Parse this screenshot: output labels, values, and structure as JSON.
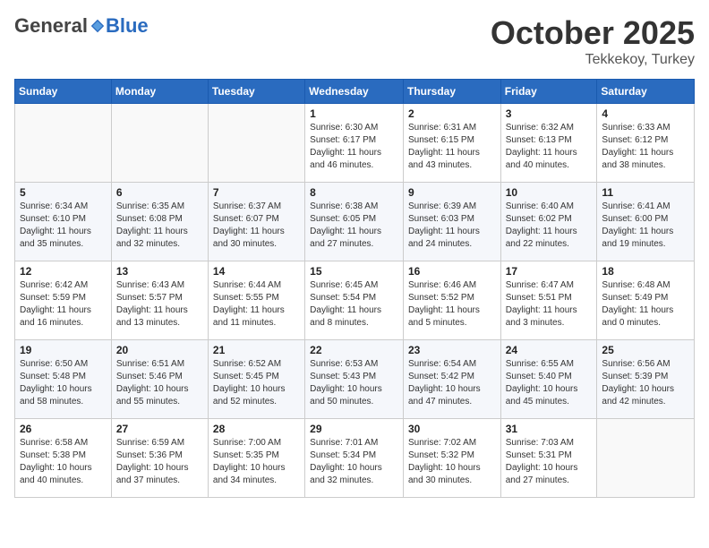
{
  "header": {
    "logo_general": "General",
    "logo_blue": "Blue",
    "month_title": "October 2025",
    "location": "Tekkekoy, Turkey"
  },
  "days_of_week": [
    "Sunday",
    "Monday",
    "Tuesday",
    "Wednesday",
    "Thursday",
    "Friday",
    "Saturday"
  ],
  "weeks": [
    [
      {
        "day": "",
        "info": ""
      },
      {
        "day": "",
        "info": ""
      },
      {
        "day": "",
        "info": ""
      },
      {
        "day": "1",
        "info": "Sunrise: 6:30 AM\nSunset: 6:17 PM\nDaylight: 11 hours\nand 46 minutes."
      },
      {
        "day": "2",
        "info": "Sunrise: 6:31 AM\nSunset: 6:15 PM\nDaylight: 11 hours\nand 43 minutes."
      },
      {
        "day": "3",
        "info": "Sunrise: 6:32 AM\nSunset: 6:13 PM\nDaylight: 11 hours\nand 40 minutes."
      },
      {
        "day": "4",
        "info": "Sunrise: 6:33 AM\nSunset: 6:12 PM\nDaylight: 11 hours\nand 38 minutes."
      }
    ],
    [
      {
        "day": "5",
        "info": "Sunrise: 6:34 AM\nSunset: 6:10 PM\nDaylight: 11 hours\nand 35 minutes."
      },
      {
        "day": "6",
        "info": "Sunrise: 6:35 AM\nSunset: 6:08 PM\nDaylight: 11 hours\nand 32 minutes."
      },
      {
        "day": "7",
        "info": "Sunrise: 6:37 AM\nSunset: 6:07 PM\nDaylight: 11 hours\nand 30 minutes."
      },
      {
        "day": "8",
        "info": "Sunrise: 6:38 AM\nSunset: 6:05 PM\nDaylight: 11 hours\nand 27 minutes."
      },
      {
        "day": "9",
        "info": "Sunrise: 6:39 AM\nSunset: 6:03 PM\nDaylight: 11 hours\nand 24 minutes."
      },
      {
        "day": "10",
        "info": "Sunrise: 6:40 AM\nSunset: 6:02 PM\nDaylight: 11 hours\nand 22 minutes."
      },
      {
        "day": "11",
        "info": "Sunrise: 6:41 AM\nSunset: 6:00 PM\nDaylight: 11 hours\nand 19 minutes."
      }
    ],
    [
      {
        "day": "12",
        "info": "Sunrise: 6:42 AM\nSunset: 5:59 PM\nDaylight: 11 hours\nand 16 minutes."
      },
      {
        "day": "13",
        "info": "Sunrise: 6:43 AM\nSunset: 5:57 PM\nDaylight: 11 hours\nand 13 minutes."
      },
      {
        "day": "14",
        "info": "Sunrise: 6:44 AM\nSunset: 5:55 PM\nDaylight: 11 hours\nand 11 minutes."
      },
      {
        "day": "15",
        "info": "Sunrise: 6:45 AM\nSunset: 5:54 PM\nDaylight: 11 hours\nand 8 minutes."
      },
      {
        "day": "16",
        "info": "Sunrise: 6:46 AM\nSunset: 5:52 PM\nDaylight: 11 hours\nand 5 minutes."
      },
      {
        "day": "17",
        "info": "Sunrise: 6:47 AM\nSunset: 5:51 PM\nDaylight: 11 hours\nand 3 minutes."
      },
      {
        "day": "18",
        "info": "Sunrise: 6:48 AM\nSunset: 5:49 PM\nDaylight: 11 hours\nand 0 minutes."
      }
    ],
    [
      {
        "day": "19",
        "info": "Sunrise: 6:50 AM\nSunset: 5:48 PM\nDaylight: 10 hours\nand 58 minutes."
      },
      {
        "day": "20",
        "info": "Sunrise: 6:51 AM\nSunset: 5:46 PM\nDaylight: 10 hours\nand 55 minutes."
      },
      {
        "day": "21",
        "info": "Sunrise: 6:52 AM\nSunset: 5:45 PM\nDaylight: 10 hours\nand 52 minutes."
      },
      {
        "day": "22",
        "info": "Sunrise: 6:53 AM\nSunset: 5:43 PM\nDaylight: 10 hours\nand 50 minutes."
      },
      {
        "day": "23",
        "info": "Sunrise: 6:54 AM\nSunset: 5:42 PM\nDaylight: 10 hours\nand 47 minutes."
      },
      {
        "day": "24",
        "info": "Sunrise: 6:55 AM\nSunset: 5:40 PM\nDaylight: 10 hours\nand 45 minutes."
      },
      {
        "day": "25",
        "info": "Sunrise: 6:56 AM\nSunset: 5:39 PM\nDaylight: 10 hours\nand 42 minutes."
      }
    ],
    [
      {
        "day": "26",
        "info": "Sunrise: 6:58 AM\nSunset: 5:38 PM\nDaylight: 10 hours\nand 40 minutes."
      },
      {
        "day": "27",
        "info": "Sunrise: 6:59 AM\nSunset: 5:36 PM\nDaylight: 10 hours\nand 37 minutes."
      },
      {
        "day": "28",
        "info": "Sunrise: 7:00 AM\nSunset: 5:35 PM\nDaylight: 10 hours\nand 34 minutes."
      },
      {
        "day": "29",
        "info": "Sunrise: 7:01 AM\nSunset: 5:34 PM\nDaylight: 10 hours\nand 32 minutes."
      },
      {
        "day": "30",
        "info": "Sunrise: 7:02 AM\nSunset: 5:32 PM\nDaylight: 10 hours\nand 30 minutes."
      },
      {
        "day": "31",
        "info": "Sunrise: 7:03 AM\nSunset: 5:31 PM\nDaylight: 10 hours\nand 27 minutes."
      },
      {
        "day": "",
        "info": ""
      }
    ]
  ]
}
